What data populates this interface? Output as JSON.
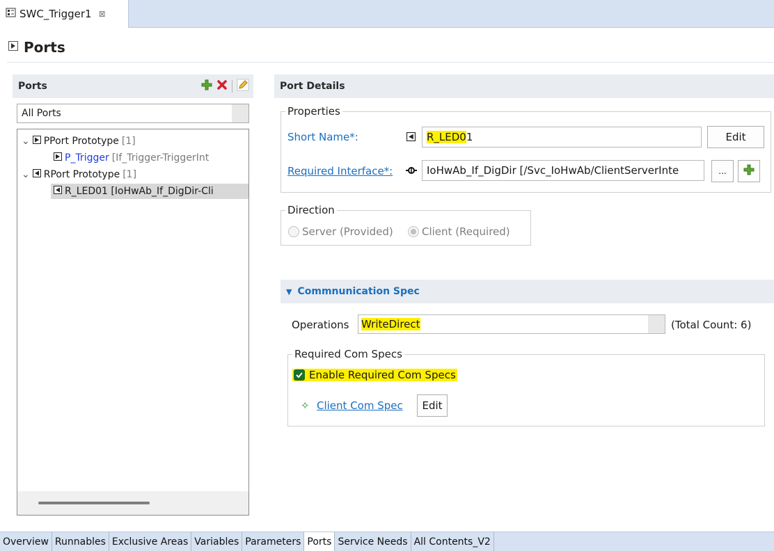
{
  "editor_tab": {
    "title": "SWC_Trigger1",
    "close": "⊠"
  },
  "page": {
    "title": "Ports"
  },
  "ports_panel": {
    "header": "Ports",
    "filter": "All Ports",
    "tree": {
      "pport": {
        "label": "PPort Prototype",
        "count": "[1]"
      },
      "p_trigger": {
        "name": "P_Trigger",
        "detail": "[If_Trigger-TriggerInt"
      },
      "rport": {
        "label": "RPort Prototype",
        "count": "[1]"
      },
      "r_led01": {
        "label": "R_LED01 [IoHwAb_If_DigDir-Cli"
      }
    }
  },
  "details": {
    "header": "Port Details",
    "properties": {
      "legend": "Properties",
      "short_name_label": "Short Name*:",
      "short_name_highlight": "R_LED0",
      "short_name_rest": "1",
      "edit_label": "Edit",
      "required_interface_label": "Required Interface*:",
      "required_interface_value": "IoHwAb_If_DigDir [/Svc_IoHwAb/ClientServerInte",
      "browse_label": "..."
    },
    "direction": {
      "legend": "Direction",
      "server": "Server (Provided)",
      "client": "Client (Required)"
    },
    "comm_spec": {
      "header": "Commnunication Spec",
      "operations_label": "Operations",
      "operations_value": "WriteDirect",
      "total_count": "(Total Count: 6)",
      "required_com_specs": {
        "legend": "Required Com Specs",
        "enable_label": "Enable Required Com Specs",
        "client_com_spec": "Client Com Spec",
        "edit_label": "Edit"
      }
    }
  },
  "bottom_tabs": [
    {
      "label": "Overview"
    },
    {
      "label": "Runnables"
    },
    {
      "label": "Exclusive Areas"
    },
    {
      "label": "Variables"
    },
    {
      "label": "Parameters"
    },
    {
      "label": "Ports",
      "active": true
    },
    {
      "label": "Service Needs"
    },
    {
      "label": "All Contents_V2"
    }
  ],
  "colors": {
    "highlight": "#ffef00",
    "link": "#1a6fbf",
    "tab_strip": "#d6e2f1"
  }
}
